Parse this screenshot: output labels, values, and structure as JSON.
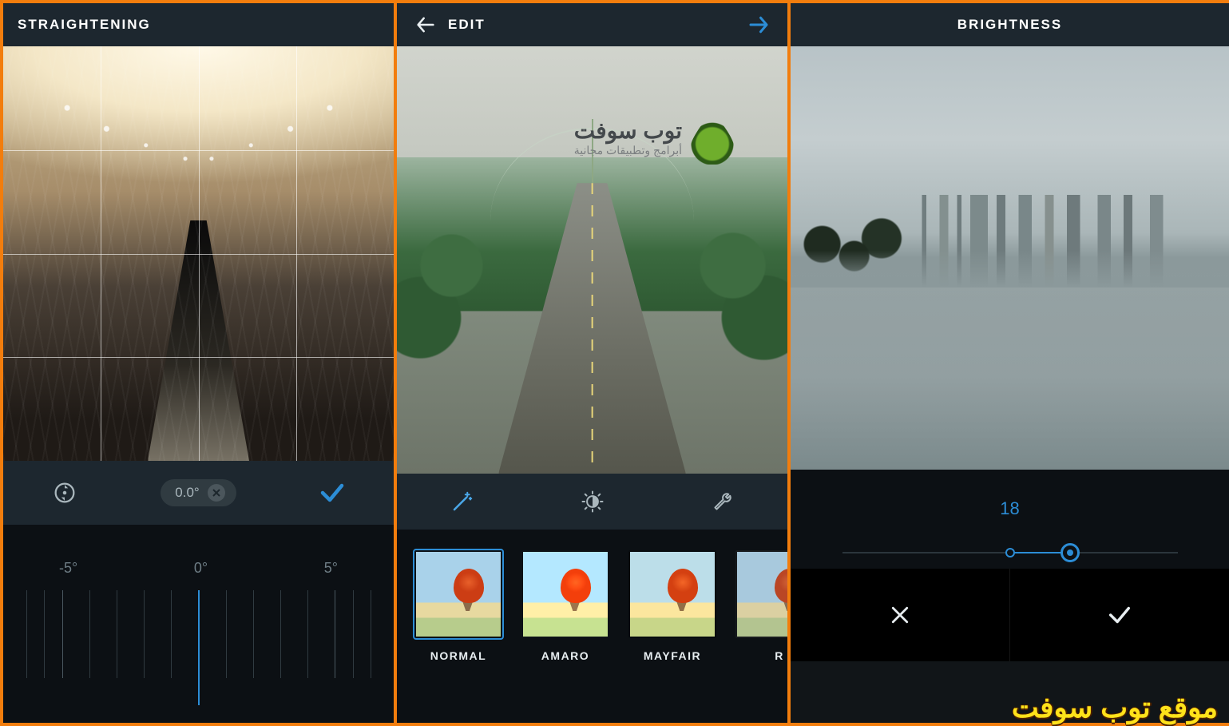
{
  "screen1": {
    "title": "STRAIGHTENING",
    "angle_value": "0.0°",
    "ruler_labels": {
      "left": "-5°",
      "center": "0°",
      "right": "5°"
    },
    "icons": {
      "rotate": "rotate-icon",
      "accept": "check-icon",
      "clear": "x-icon"
    }
  },
  "screen2": {
    "title": "EDIT",
    "tools": [
      {
        "name": "magic-wand-icon",
        "active": true
      },
      {
        "name": "brightness-contrast-icon",
        "active": false
      },
      {
        "name": "wrench-icon",
        "active": false
      }
    ],
    "filters": [
      {
        "label": "NORMAL",
        "variant": "normal",
        "selected": true
      },
      {
        "label": "AMARO",
        "variant": "amaro",
        "selected": false
      },
      {
        "label": "MAYFAIR",
        "variant": "mayfair",
        "selected": false
      },
      {
        "label": "R",
        "variant": "ri",
        "selected": false
      }
    ],
    "watermark": {
      "line1": "توب سوفت",
      "line2": "أبرامج وتطبيقات مجانية"
    }
  },
  "screen3": {
    "title": "BRIGHTNESS",
    "value": "18",
    "slider": {
      "origin_pct": 50,
      "knob_pct": 68
    },
    "actions": {
      "cancel": "close-icon",
      "accept": "check-icon"
    }
  },
  "footer_watermark": "موقع توب سوفت",
  "colors": {
    "accent": "#2c8dd6",
    "frame": "#f27d0d",
    "bar": "#1d272f"
  }
}
